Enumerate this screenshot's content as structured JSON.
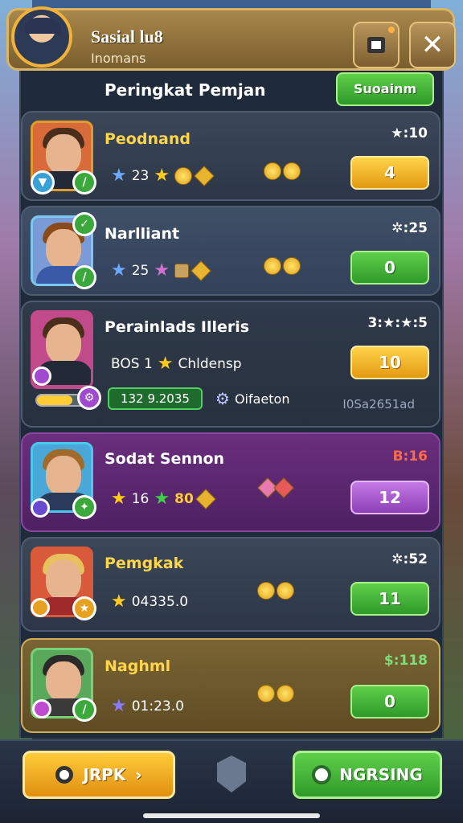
{
  "header": {
    "title": "Sasial lu8",
    "subtitle": "Inomans",
    "btn1_icon": "square-icon",
    "btn2_label": "✕"
  },
  "panel": {
    "title": "Peringkat Pemjan",
    "top_button": "Suoainm"
  },
  "rows": [
    {
      "name": "Peodnand",
      "score": "★:10",
      "stat": "23",
      "rank": "4"
    },
    {
      "name": "Narlliant",
      "score": "✲:25",
      "stat": "25",
      "rank": "0"
    },
    {
      "name": "Perainlads Illeris",
      "score": "3:★:★:5",
      "stat": "BOS 1",
      "stat2": "Chldensp",
      "rank": "10",
      "pill": "132 9.2035",
      "cog": "Oifaeton",
      "sub": "I0Sa2651ad"
    },
    {
      "name": "Sodat Sennon",
      "score": "B:16",
      "stat": "16",
      "stat_b": "80",
      "rank": "12"
    },
    {
      "name": "Pemgkak",
      "score": "✲:52",
      "stat": "04335.0",
      "rank": "11"
    },
    {
      "name": "Naghml",
      "score": "$:118",
      "stat": "01:23.0",
      "rank": "0"
    }
  ],
  "bottom": {
    "left_button": "JRPK",
    "right_button": "NGRSING"
  },
  "colors": {
    "accent_gold": "#e2a21a",
    "accent_green": "#2f9a2a",
    "accent_purple": "#8e3fb7"
  }
}
